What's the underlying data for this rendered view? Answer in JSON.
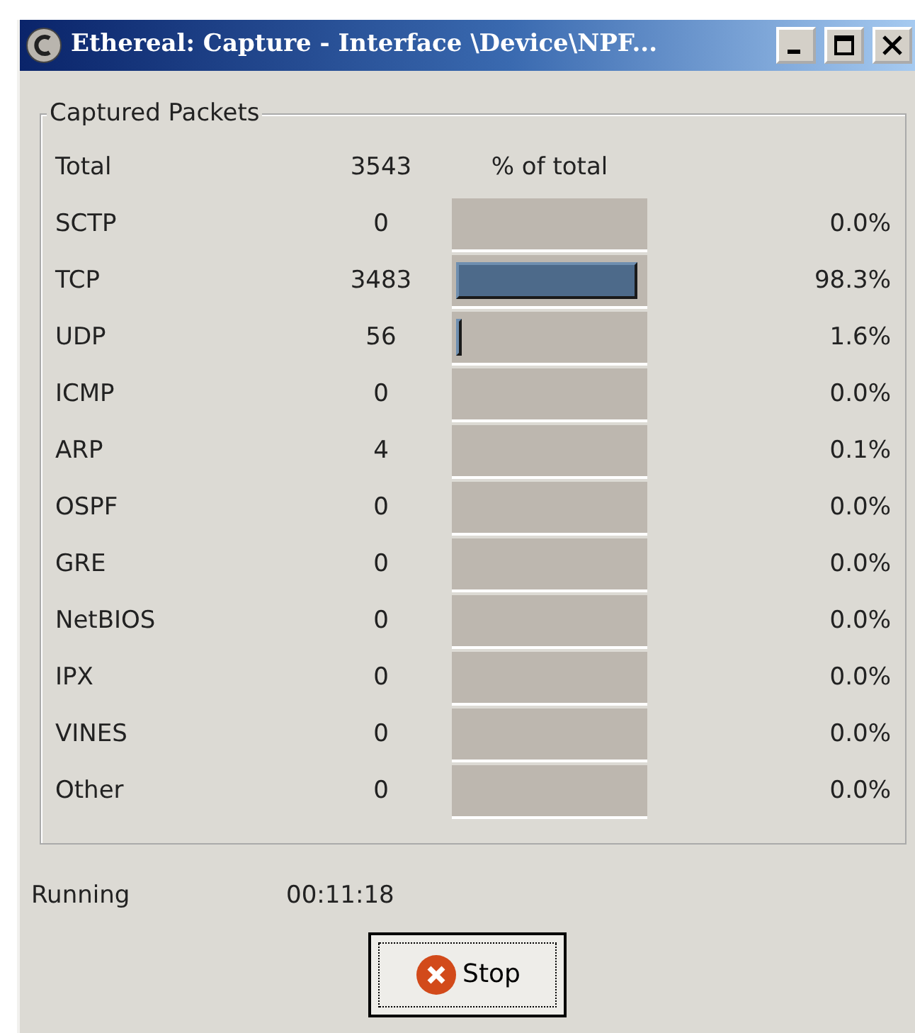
{
  "window": {
    "title": "Ethereal: Capture - Interface \\Device\\NPF..."
  },
  "group": {
    "title": "Captured Packets",
    "total": {
      "label": "Total",
      "count": "3543",
      "bar_heading": "% of total"
    },
    "rows": [
      {
        "label": "SCTP",
        "count": "0",
        "level": 0,
        "percent": "0.0%"
      },
      {
        "label": "TCP",
        "count": "3483",
        "level": 0.983,
        "percent": "98.3%"
      },
      {
        "label": "UDP",
        "count": "56",
        "level": 0.016,
        "percent": "1.6%"
      },
      {
        "label": "ICMP",
        "count": "0",
        "level": 0,
        "percent": "0.0%"
      },
      {
        "label": "ARP",
        "count": "4",
        "level": 0.001,
        "percent": "0.1%"
      },
      {
        "label": "OSPF",
        "count": "0",
        "level": 0,
        "percent": "0.0%"
      },
      {
        "label": "GRE",
        "count": "0",
        "level": 0,
        "percent": "0.0%"
      },
      {
        "label": "NetBIOS",
        "count": "0",
        "level": 0,
        "percent": "0.0%"
      },
      {
        "label": "IPX",
        "count": "0",
        "level": 0,
        "percent": "0.0%"
      },
      {
        "label": "VINES",
        "count": "0",
        "level": 0,
        "percent": "0.0%"
      },
      {
        "label": "Other",
        "count": "0",
        "level": 0,
        "percent": "0.0%"
      }
    ]
  },
  "status": {
    "label": "Running",
    "elapsed": "00:11:18"
  },
  "stop_button": {
    "label": "Stop"
  }
}
